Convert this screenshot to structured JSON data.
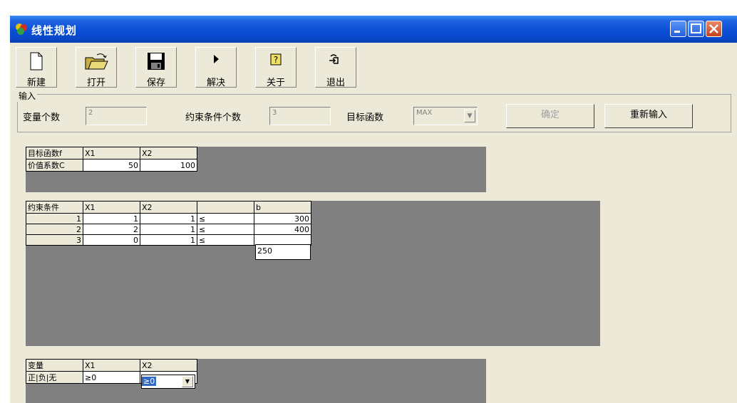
{
  "window": {
    "title": "线性规划"
  },
  "toolbar": {
    "new": "新建",
    "open": "打开",
    "save": "保存",
    "solve": "解决",
    "about": "关于",
    "exit": "退出"
  },
  "input": {
    "group_label": "输入",
    "var_count_label": "变量个数",
    "var_count": "2",
    "constraint_count_label": "约束条件个数",
    "constraint_count": "3",
    "objective_label": "目标函数",
    "objective": "MAX",
    "confirm_label": "确定",
    "reset_label": "重新输入"
  },
  "objective_table": {
    "headers": [
      "目标函数f",
      "X1",
      "X2"
    ],
    "row": {
      "label": "价值系数C",
      "x1": "50",
      "x2": "100"
    }
  },
  "constraints_table": {
    "headers": [
      "约束条件",
      "X1",
      "X2",
      "",
      "b"
    ],
    "rows": [
      {
        "n": "1",
        "x1": "1",
        "x2": "1",
        "op": "≤",
        "b": "300"
      },
      {
        "n": "2",
        "x1": "2",
        "x2": "1",
        "op": "≤",
        "b": "400"
      },
      {
        "n": "3",
        "x1": "0",
        "x2": "1",
        "op": "≤",
        "b": "250"
      }
    ]
  },
  "vars_table": {
    "headers": [
      "变量",
      "X1",
      "X2"
    ],
    "row": {
      "label": "正|负|无",
      "x1": "≥0",
      "x2": "≥0"
    }
  }
}
